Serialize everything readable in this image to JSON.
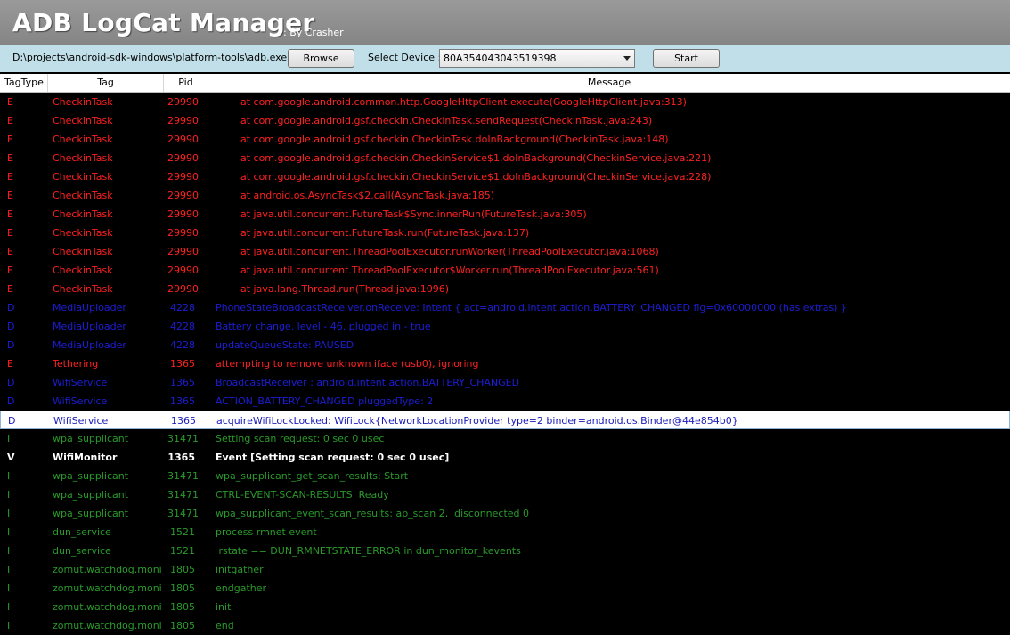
{
  "app": {
    "title": "ADB LogCat Manager",
    "byline": ": By Crasher"
  },
  "toolbar": {
    "adb_path": "D:\\projects\\android-sdk-windows\\platform-tools\\adb.exe",
    "browse_label": "Browse",
    "select_device_label": "Select Device :",
    "device_value": "80A354043043519398",
    "start_label": "Start"
  },
  "columns": {
    "tagtype": "TagType",
    "tag": "Tag",
    "pid": "Pid",
    "message": "Message"
  },
  "colors": {
    "error": "#ff2020",
    "debug": "#1d1dd6",
    "info": "#2a9a2a",
    "verbose": "#ffffff",
    "selected_text": "#1a1ab8"
  },
  "rows": [
    {
      "type": "E",
      "tag": "CheckinTask",
      "pid": "29990",
      "msg": "        at com.google.android.common.http.GoogleHttpClient.execute(GoogleHttpClient.java:313)"
    },
    {
      "type": "E",
      "tag": "CheckinTask",
      "pid": "29990",
      "msg": "        at com.google.android.gsf.checkin.CheckinTask.sendRequest(CheckinTask.java:243)"
    },
    {
      "type": "E",
      "tag": "CheckinTask",
      "pid": "29990",
      "msg": "        at com.google.android.gsf.checkin.CheckinTask.doInBackground(CheckinTask.java:148)"
    },
    {
      "type": "E",
      "tag": "CheckinTask",
      "pid": "29990",
      "msg": "        at com.google.android.gsf.checkin.CheckinService$1.doInBackground(CheckinService.java:221)"
    },
    {
      "type": "E",
      "tag": "CheckinTask",
      "pid": "29990",
      "msg": "        at com.google.android.gsf.checkin.CheckinService$1.doInBackground(CheckinService.java:228)"
    },
    {
      "type": "E",
      "tag": "CheckinTask",
      "pid": "29990",
      "msg": "        at android.os.AsyncTask$2.call(AsyncTask.java:185)"
    },
    {
      "type": "E",
      "tag": "CheckinTask",
      "pid": "29990",
      "msg": "        at java.util.concurrent.FutureTask$Sync.innerRun(FutureTask.java:305)"
    },
    {
      "type": "E",
      "tag": "CheckinTask",
      "pid": "29990",
      "msg": "        at java.util.concurrent.FutureTask.run(FutureTask.java:137)"
    },
    {
      "type": "E",
      "tag": "CheckinTask",
      "pid": "29990",
      "msg": "        at java.util.concurrent.ThreadPoolExecutor.runWorker(ThreadPoolExecutor.java:1068)"
    },
    {
      "type": "E",
      "tag": "CheckinTask",
      "pid": "29990",
      "msg": "        at java.util.concurrent.ThreadPoolExecutor$Worker.run(ThreadPoolExecutor.java:561)"
    },
    {
      "type": "E",
      "tag": "CheckinTask",
      "pid": "29990",
      "msg": "        at java.lang.Thread.run(Thread.java:1096)"
    },
    {
      "type": "D",
      "tag": "MediaUploader",
      "pid": "4228",
      "msg": "PhoneStateBroadcastReceiver.onReceive: Intent { act=android.intent.action.BATTERY_CHANGED flg=0x60000000 (has extras) }"
    },
    {
      "type": "D",
      "tag": "MediaUploader",
      "pid": "4228",
      "msg": "Battery change. level - 46. plugged in - true"
    },
    {
      "type": "D",
      "tag": "MediaUploader",
      "pid": "4228",
      "msg": "updateQueueState: PAUSED"
    },
    {
      "type": "E",
      "tag": "Tethering",
      "pid": "1365",
      "msg": "attempting to remove unknown iface (usb0), ignoring"
    },
    {
      "type": "D",
      "tag": "WifiService",
      "pid": "1365",
      "msg": "BroadcastReceiver : android.intent.action.BATTERY_CHANGED"
    },
    {
      "type": "D",
      "tag": "WifiService",
      "pid": "1365",
      "msg": "ACTION_BATTERY_CHANGED pluggedType: 2"
    },
    {
      "type": "D",
      "tag": "WifiService",
      "pid": "1365",
      "msg": "acquireWifiLockLocked: WifiLock{NetworkLocationProvider type=2 binder=android.os.Binder@44e854b0}",
      "selected": true
    },
    {
      "type": "I",
      "tag": "wpa_supplicant",
      "pid": "31471",
      "msg": "Setting scan request: 0 sec 0 usec"
    },
    {
      "type": "V",
      "tag": "WifiMonitor",
      "pid": "1365",
      "msg": "Event [Setting scan request: 0 sec 0 usec]"
    },
    {
      "type": "I",
      "tag": "wpa_supplicant",
      "pid": "31471",
      "msg": "wpa_supplicant_get_scan_results: Start"
    },
    {
      "type": "I",
      "tag": "wpa_supplicant",
      "pid": "31471",
      "msg": "CTRL-EVENT-SCAN-RESULTS  Ready"
    },
    {
      "type": "I",
      "tag": "wpa_supplicant",
      "pid": "31471",
      "msg": "wpa_supplicant_event_scan_results: ap_scan 2,  disconnected 0"
    },
    {
      "type": "I",
      "tag": "dun_service",
      "pid": "1521",
      "msg": "process rmnet event"
    },
    {
      "type": "I",
      "tag": "dun_service",
      "pid": "1521",
      "msg": " rstate == DUN_RMNETSTATE_ERROR in dun_monitor_kevents"
    },
    {
      "type": "I",
      "tag": "zomut.watchdog.moni",
      "pid": "1805",
      "msg": "initgather"
    },
    {
      "type": "I",
      "tag": "zomut.watchdog.moni",
      "pid": "1805",
      "msg": "endgather"
    },
    {
      "type": "I",
      "tag": "zomut.watchdog.moni",
      "pid": "1805",
      "msg": "init"
    },
    {
      "type": "I",
      "tag": "zomut.watchdog.moni",
      "pid": "1805",
      "msg": "end"
    }
  ]
}
